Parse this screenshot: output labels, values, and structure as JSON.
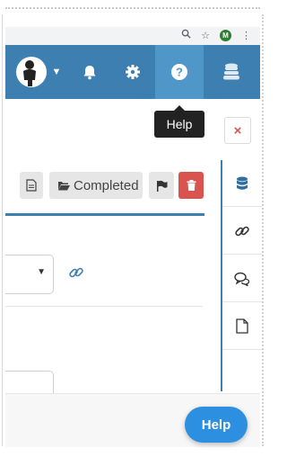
{
  "browser": {
    "profile_initial": "M",
    "icons": [
      "zoom-icon",
      "star-icon",
      "profile-avatar",
      "more-vert-icon"
    ]
  },
  "topbar": {
    "icons": [
      "user-avatar-icon",
      "chevron-down-icon",
      "bell-icon",
      "gear-icon",
      "question-icon",
      "database-icon"
    ],
    "active_item": "help",
    "color": "#3d7fb0"
  },
  "tooltip": {
    "text": "Help"
  },
  "close_button": {
    "symbol": "×",
    "color": "#d9534f"
  },
  "toolbar": {
    "completed_label": "Completed",
    "icons": [
      "file-icon",
      "folder-open-icon",
      "flag-icon",
      "trash-icon"
    ]
  },
  "side_tabs": [
    "database-icon",
    "link-icon",
    "comments-icon",
    "document-icon"
  ],
  "help_button": {
    "label": "Help",
    "color": "#2d8fe0"
  }
}
